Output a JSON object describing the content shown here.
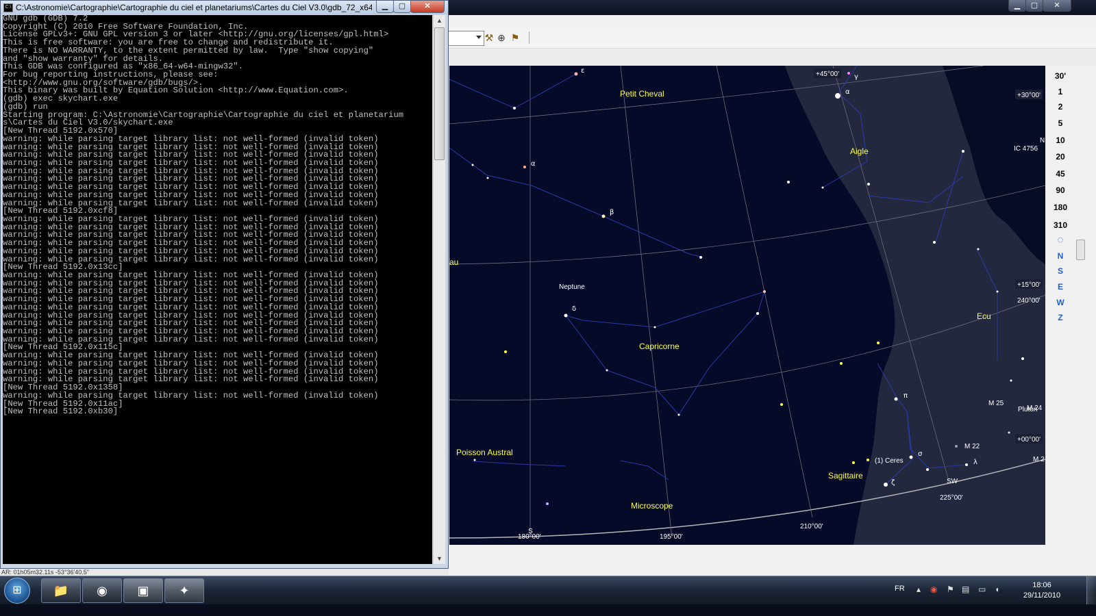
{
  "gdb_window": {
    "title": "C:\\Astronomie\\Cartographie\\Cartographie du ciel et planetariums\\Cartes du Ciel V3.0\\gdb_72_x64...",
    "console_lines": [
      "GNU gdb (GDB) 7.2",
      "Copyright (C) 2010 Free Software Foundation, Inc.",
      "License GPLv3+: GNU GPL version 3 or later <http://gnu.org/licenses/gpl.html>",
      "This is free software: you are free to change and redistribute it.",
      "There is NO WARRANTY, to the extent permitted by law.  Type \"show copying\"",
      "and \"show warranty\" for details.",
      "This GDB was configured as \"x86_64-w64-mingw32\".",
      "For bug reporting instructions, please see:",
      "<http://www.gnu.org/software/gdb/bugs/>.",
      "This binary was built by Equation Solution <http://www.Equation.com>.",
      "(gdb) exec skychart.exe",
      "(gdb) run",
      "Starting program: C:\\Astronomie\\Cartographie\\Cartographie du ciel et planetarium",
      "s\\Cartes du Ciel V3.0/skychart.exe",
      "[New Thread 5192.0x570]",
      "warning: while parsing target library list: not well-formed (invalid token)",
      "warning: while parsing target library list: not well-formed (invalid token)",
      "warning: while parsing target library list: not well-formed (invalid token)",
      "warning: while parsing target library list: not well-formed (invalid token)",
      "warning: while parsing target library list: not well-formed (invalid token)",
      "warning: while parsing target library list: not well-formed (invalid token)",
      "warning: while parsing target library list: not well-formed (invalid token)",
      "warning: while parsing target library list: not well-formed (invalid token)",
      "warning: while parsing target library list: not well-formed (invalid token)",
      "[New Thread 5192.0xcf8]",
      "warning: while parsing target library list: not well-formed (invalid token)",
      "warning: while parsing target library list: not well-formed (invalid token)",
      "warning: while parsing target library list: not well-formed (invalid token)",
      "warning: while parsing target library list: not well-formed (invalid token)",
      "warning: while parsing target library list: not well-formed (invalid token)",
      "warning: while parsing target library list: not well-formed (invalid token)",
      "[New Thread 5192.0x13cc]",
      "warning: while parsing target library list: not well-formed (invalid token)",
      "warning: while parsing target library list: not well-formed (invalid token)",
      "warning: while parsing target library list: not well-formed (invalid token)",
      "warning: while parsing target library list: not well-formed (invalid token)",
      "warning: while parsing target library list: not well-formed (invalid token)",
      "warning: while parsing target library list: not well-formed (invalid token)",
      "warning: while parsing target library list: not well-formed (invalid token)",
      "warning: while parsing target library list: not well-formed (invalid token)",
      "warning: while parsing target library list: not well-formed (invalid token)",
      "[New Thread 5192.0x115c]",
      "warning: while parsing target library list: not well-formed (invalid token)",
      "warning: while parsing target library list: not well-formed (invalid token)",
      "warning: while parsing target library list: not well-formed (invalid token)",
      "warning: while parsing target library list: not well-formed (invalid token)",
      "[New Thread 5192.0x1358]",
      "warning: while parsing target library list: not well-formed (invalid token)",
      "[New Thread 5192.0x11ac]",
      "[New Thread 5192.0xb30]"
    ],
    "status_strip": "AR: 01h05m32.11s  -53°36'40.5\""
  },
  "sky_chart": {
    "constellations": [
      "Petit Cheval",
      "Aigle",
      "Capricorne",
      "Poisson Austral",
      "Microscope",
      "Sagittaire",
      "Ecu"
    ],
    "objects": [
      "Neptune",
      "(1) Ceres",
      "IC 4756",
      "M 25",
      "M 22",
      "Pluton",
      "M 24",
      "M 2"
    ],
    "edge_labels": [
      "au",
      "N"
    ],
    "greek": [
      "ε",
      "α",
      "β",
      "δ",
      "γ",
      "α",
      "π",
      "σ",
      "ζ",
      "λ"
    ],
    "declination_labels": [
      "+45°00'",
      "+30°00'",
      "+15°00'",
      "+00°00'"
    ],
    "ra_labels": [
      "180°00'",
      "195°00'",
      "210°00'",
      "225°00'",
      "240°00'"
    ],
    "horizon_labels": [
      "S",
      "SW"
    ],
    "colors": {
      "sky": "#050a28",
      "milky_way": "#23283f",
      "constellation_name": "#ffff40",
      "grid": "#6d6d7a",
      "lines": "#2a3aa8",
      "horizon": "#b7b7b7"
    }
  },
  "zoom_panel": {
    "levels": [
      "30'",
      "1",
      "2",
      "5",
      "10",
      "20",
      "45",
      "90",
      "180",
      "310"
    ],
    "directions": [
      "N",
      "S",
      "E",
      "W",
      "Z"
    ]
  },
  "taskbar": {
    "language": "FR",
    "time": "18:06",
    "date": "29/11/2010"
  }
}
